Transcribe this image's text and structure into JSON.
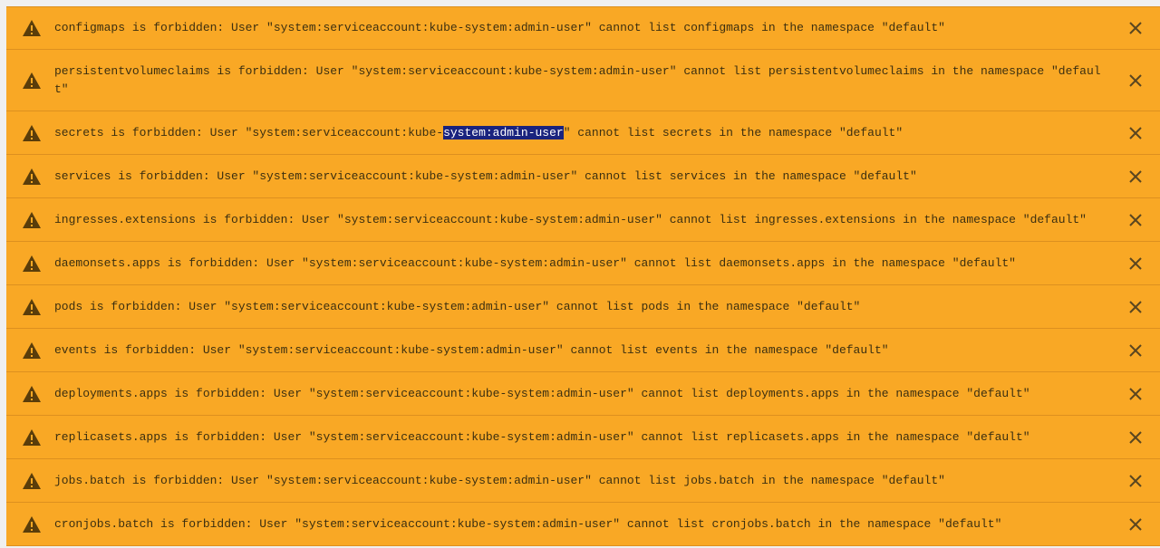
{
  "colors": {
    "warning_background": "#f9a825",
    "text": "#3c2f10",
    "selection": "#1a237e"
  },
  "icons": {
    "row_icon": "warning-icon",
    "dismiss_icon": "close-icon"
  },
  "notifications": [
    {
      "message": "configmaps is forbidden: User \"system:serviceaccount:kube-system:admin-user\" cannot list configmaps in the namespace \"default\""
    },
    {
      "message": "persistentvolumeclaims is forbidden: User \"system:serviceaccount:kube-system:admin-user\" cannot list persistentvolumeclaims in the namespace \"default\""
    },
    {
      "message_before": "secrets is forbidden: User \"system:serviceaccount:kube-",
      "message_selected": "system:admin-user",
      "message_after": "\" cannot list secrets in the namespace \"default\""
    },
    {
      "message": "services is forbidden: User \"system:serviceaccount:kube-system:admin-user\" cannot list services in the namespace \"default\""
    },
    {
      "message": "ingresses.extensions is forbidden: User \"system:serviceaccount:kube-system:admin-user\" cannot list ingresses.extensions in the namespace \"default\""
    },
    {
      "message": "daemonsets.apps is forbidden: User \"system:serviceaccount:kube-system:admin-user\" cannot list daemonsets.apps in the namespace \"default\""
    },
    {
      "message": "pods is forbidden: User \"system:serviceaccount:kube-system:admin-user\" cannot list pods in the namespace \"default\""
    },
    {
      "message": "events is forbidden: User \"system:serviceaccount:kube-system:admin-user\" cannot list events in the namespace \"default\""
    },
    {
      "message": "deployments.apps is forbidden: User \"system:serviceaccount:kube-system:admin-user\" cannot list deployments.apps in the namespace \"default\""
    },
    {
      "message": "replicasets.apps is forbidden: User \"system:serviceaccount:kube-system:admin-user\" cannot list replicasets.apps in the namespace \"default\""
    },
    {
      "message": "jobs.batch is forbidden: User \"system:serviceaccount:kube-system:admin-user\" cannot list jobs.batch in the namespace \"default\""
    },
    {
      "message": "cronjobs.batch is forbidden: User \"system:serviceaccount:kube-system:admin-user\" cannot list cronjobs.batch in the namespace \"default\""
    }
  ]
}
